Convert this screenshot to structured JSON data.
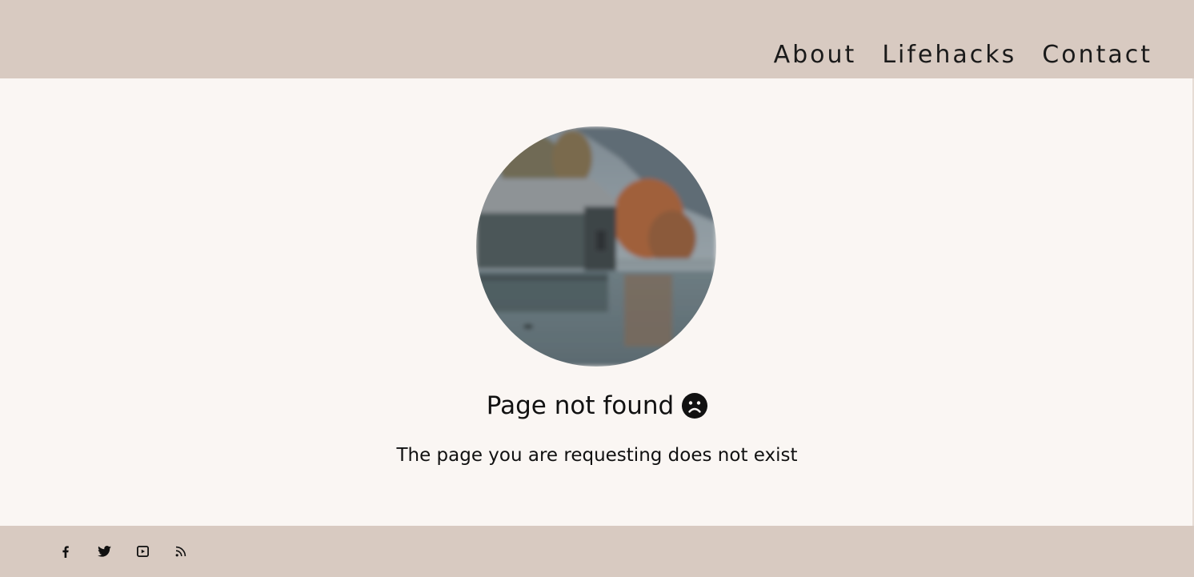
{
  "nav": {
    "items": [
      {
        "label": "About"
      },
      {
        "label": "Lifehacks"
      },
      {
        "label": "Contact"
      }
    ]
  },
  "main": {
    "title": "Page not found",
    "title_icon": "sad-face-icon",
    "subtitle": "The page you are requesting does not exist",
    "image": {
      "subject": "boathouse-on-lake-photo"
    }
  },
  "footer": {
    "social": [
      {
        "icon": "facebook-icon"
      },
      {
        "icon": "twitter-icon"
      },
      {
        "icon": "youtube-icon"
      },
      {
        "icon": "rss-icon"
      }
    ]
  },
  "colors": {
    "header_bg": "#d8cac1",
    "footer_bg": "#d8cac1",
    "page_bg": "#faf6f3",
    "text": "#111111"
  }
}
